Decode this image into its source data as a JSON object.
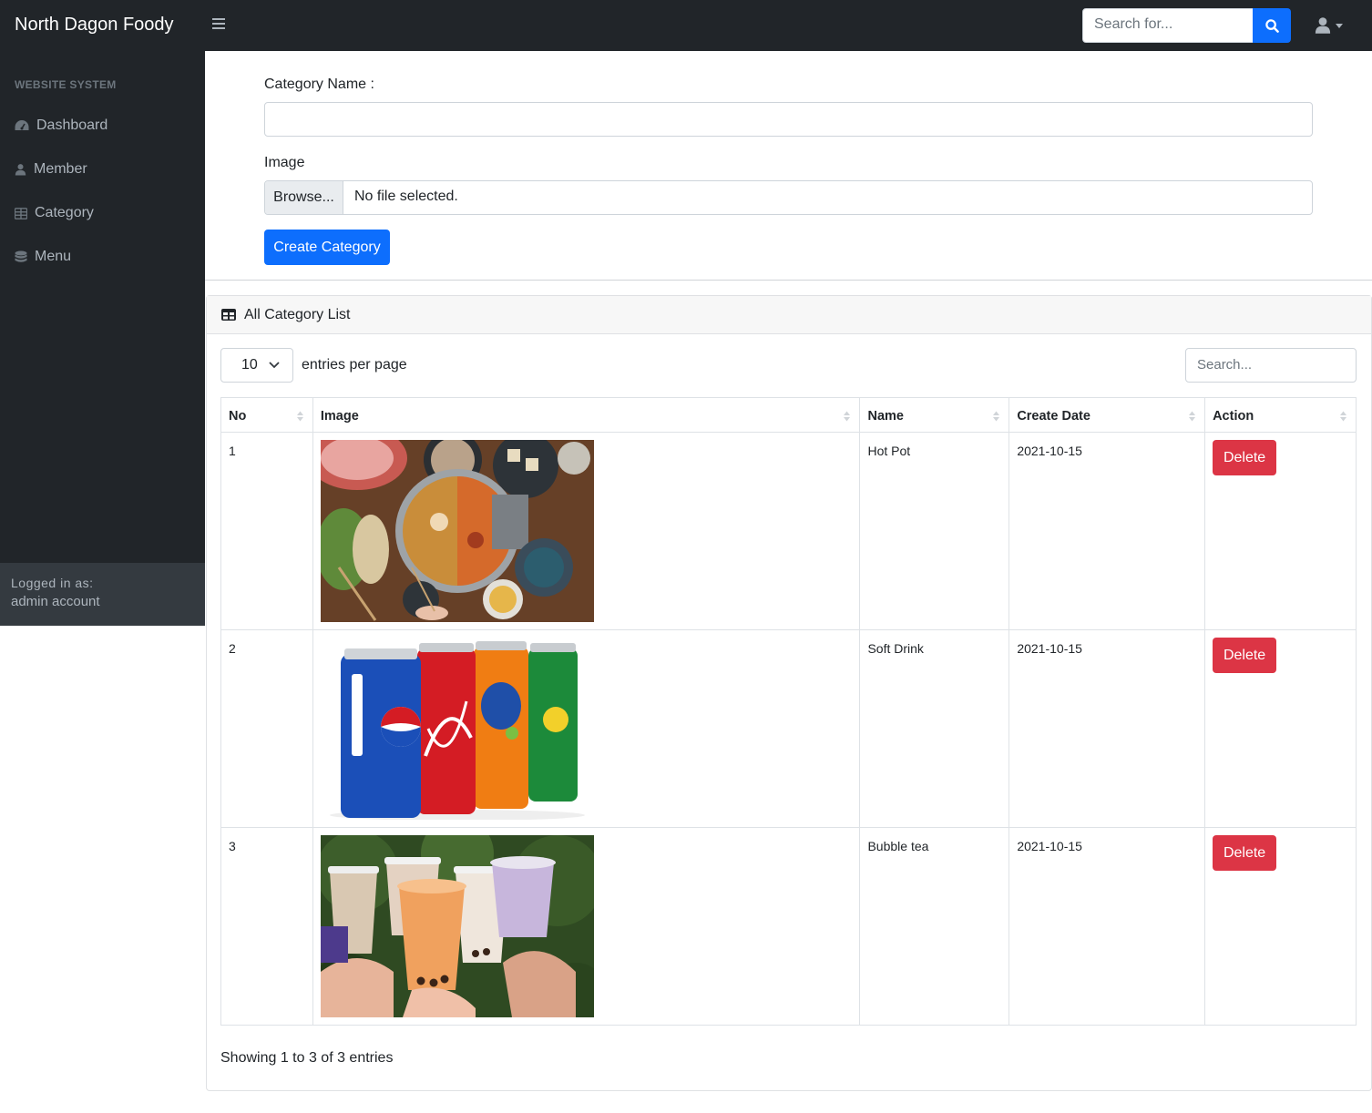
{
  "app": {
    "brand": "North Dagon Foody"
  },
  "topnav": {
    "search_placeholder": "Search for..."
  },
  "sidebar": {
    "heading": "WEBSITE SYSTEM",
    "items": [
      {
        "label": "Dashboard",
        "icon": "dashboard-icon"
      },
      {
        "label": "Member",
        "icon": "user-icon"
      },
      {
        "label": "Category",
        "icon": "table-icon"
      },
      {
        "label": "Menu",
        "icon": "database-icon"
      }
    ],
    "footer": {
      "logged_in_label": "Logged in as:",
      "account": "admin account"
    }
  },
  "form": {
    "category_name_label": "Category Name :",
    "category_name_value": "",
    "image_label": "Image",
    "browse_label": "Browse...",
    "file_status": "No file selected.",
    "submit_label": "Create Category"
  },
  "card": {
    "title": "All Category List",
    "per_page_value": "10",
    "per_page_label": "entries per page",
    "search_placeholder": "Search...",
    "columns": [
      "No",
      "Image",
      "Name",
      "Create Date",
      "Action"
    ],
    "rows": [
      {
        "no": "1",
        "image": "hot-pot-photo",
        "name": "Hot Pot",
        "date": "2021-10-15",
        "action": "Delete"
      },
      {
        "no": "2",
        "image": "soft-drink-photo",
        "name": "Soft Drink",
        "date": "2021-10-15",
        "action": "Delete"
      },
      {
        "no": "3",
        "image": "bubble-tea-photo",
        "name": "Bubble tea",
        "date": "2021-10-15",
        "action": "Delete"
      }
    ],
    "showing": "Showing 1 to 3 of 3 entries"
  },
  "colors": {
    "nav_bg": "#212529",
    "primary": "#0d6efd",
    "danger": "#dc3545"
  }
}
